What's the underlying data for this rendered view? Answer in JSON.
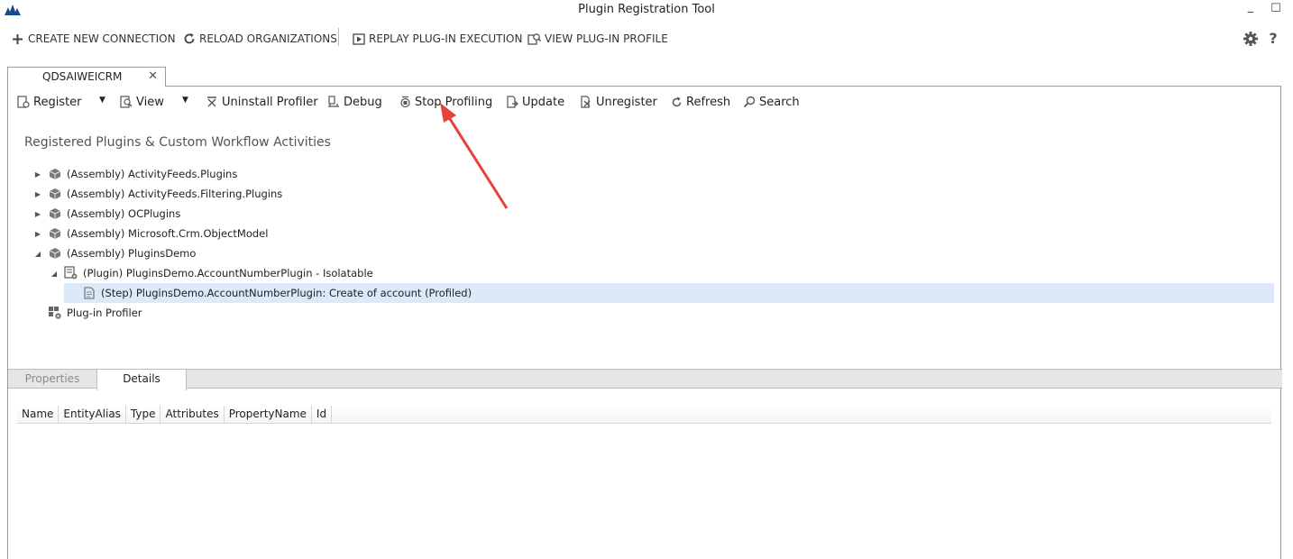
{
  "window": {
    "title": "Plugin Registration Tool",
    "minimize_glyph": "_",
    "maximize_glyph": "☐"
  },
  "commandbar": {
    "items": [
      {
        "label": "CREATE NEW CONNECTION",
        "icon": "plus-icon"
      },
      {
        "label": "RELOAD ORGANIZATIONS",
        "icon": "reload-icon"
      },
      {
        "label": "REPLAY PLUG-IN EXECUTION",
        "icon": "replay-icon"
      },
      {
        "label": "VIEW PLUG-IN PROFILE",
        "icon": "profile-icon"
      }
    ],
    "help_label": "?"
  },
  "connection_tab": {
    "label": "QDSAIWEICRM",
    "close_glyph": "✕"
  },
  "toolbar": {
    "register": "Register",
    "view": "View",
    "uninstall_profiler": "Uninstall Profiler",
    "debug": "Debug",
    "stop_profiling": "Stop Profiling",
    "update": "Update",
    "unregister": "Unregister",
    "refresh": "Refresh",
    "search": "Search"
  },
  "tree": {
    "title": "Registered Plugins & Custom Workflow Activities",
    "nodes": [
      {
        "label": "(Assembly) ActivityFeeds.Plugins",
        "expanded": false
      },
      {
        "label": "(Assembly) ActivityFeeds.Filtering.Plugins",
        "expanded": false
      },
      {
        "label": "(Assembly) OCPlugins",
        "expanded": false
      },
      {
        "label": "(Assembly) Microsoft.Crm.ObjectModel",
        "expanded": false
      },
      {
        "label": "(Assembly) PluginsDemo",
        "expanded": true
      },
      {
        "label": "(Plugin) PluginsDemo.AccountNumberPlugin - Isolatable",
        "expanded": true
      },
      {
        "label": "(Step) PluginsDemo.AccountNumberPlugin: Create of account (Profiled)",
        "selected": true
      },
      {
        "label": "Plug-in Profiler"
      }
    ]
  },
  "bottom_tabs": {
    "properties": "Properties",
    "details": "Details",
    "active": "Details"
  },
  "details_grid": {
    "columns": [
      "Name",
      "EntityAlias",
      "Type",
      "Attributes",
      "PropertyName",
      "Id"
    ]
  },
  "colors": {
    "selected_row": "#dce9f8",
    "annotation_arrow": "#e8403a",
    "tab_strip": "#e6e6e6"
  }
}
